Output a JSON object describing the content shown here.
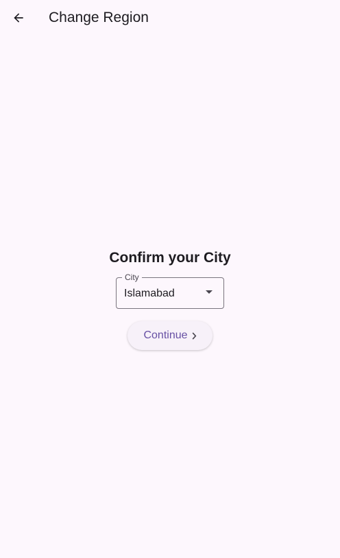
{
  "app_bar": {
    "back_icon": "arrow-back-icon",
    "title": "Change Region"
  },
  "main": {
    "heading": "Confirm your City",
    "city_dropdown": {
      "label": "City",
      "value": "Islamabad",
      "arrow_icon": "dropdown-arrow-icon"
    },
    "continue_button": {
      "label": "Continue",
      "icon": "chevron-right-icon"
    }
  },
  "colors": {
    "background": "#fdf7fd",
    "accent": "#6750a4",
    "outline": "#79747e",
    "text": "#1d1b20"
  }
}
